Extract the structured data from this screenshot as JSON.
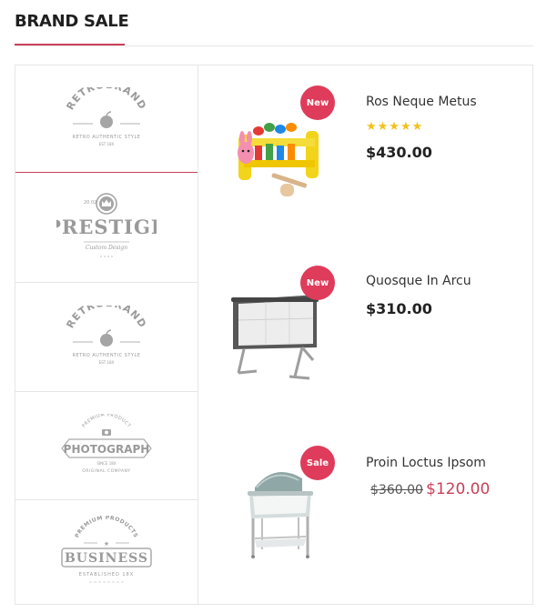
{
  "header": {
    "title": "BRAND SALE"
  },
  "colors": {
    "accent": "#c94059",
    "badge": "#df3b5a",
    "star": "#f2c21a"
  },
  "brands": [
    {
      "name": "RETROBRAND",
      "tagline": "RETRO AUTHENTIC STYLE",
      "est": "EST 18X",
      "icon": "apple-icon"
    },
    {
      "name": "PRESTIGE",
      "tagline": "Custom Design",
      "est": "20 02",
      "icon": "crown-icon"
    },
    {
      "name": "RETROBRAND",
      "tagline": "RETRO AUTHENTIC STYLE",
      "est": "EST 18X",
      "icon": "apple-icon"
    },
    {
      "name": "PHOTOGRAPH",
      "tagline": "ORIGINAL COMPANY",
      "top": "PREMIUM PRODUCT",
      "est": "SINCE 18X",
      "icon": "camera-icon"
    },
    {
      "name": "BUSINESS",
      "tagline": "ESTABLISHED 18X",
      "top": "PREMIUM PRODUCTS",
      "icon": "star-icon"
    }
  ],
  "products": [
    {
      "name": "Ros Neque Metus",
      "badge": "New",
      "rating": "★★★★★",
      "price": "$430.00"
    },
    {
      "name": "Quosque In Arcu",
      "badge": "New",
      "price": "$310.00"
    },
    {
      "name": "Proin Loctus Ipsom",
      "badge": "Sale",
      "old_price": "$360.00",
      "price": "$120.00"
    }
  ]
}
